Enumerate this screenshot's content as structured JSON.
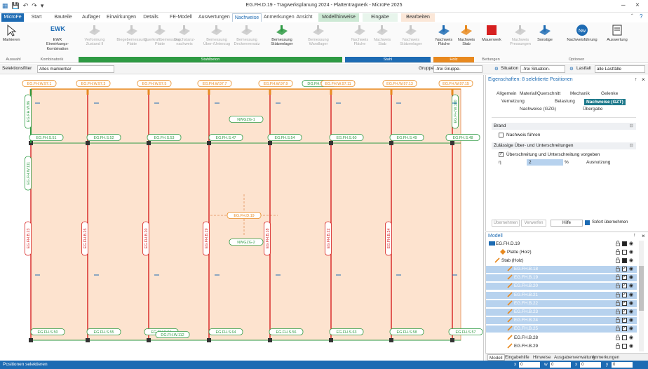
{
  "window": {
    "title": "EG.FH.D.19 - Tragwerksplanung 2024 - Plattentragwerk - MicroFe 2025"
  },
  "tabs": [
    {
      "label": "MicroFe",
      "kind": "file"
    },
    {
      "label": "Start",
      "kind": "plain"
    },
    {
      "label": "Bauteile",
      "kind": "plain"
    },
    {
      "label": "Auflager",
      "kind": "plain"
    },
    {
      "label": "Einwirkungen",
      "kind": "plain"
    },
    {
      "label": "Details",
      "kind": "plain"
    },
    {
      "label": "FE-Modell",
      "kind": "plain"
    },
    {
      "label": "Auswertungen",
      "kind": "plain"
    },
    {
      "label": "Nachweise",
      "kind": "active"
    },
    {
      "label": "Anmerkungen",
      "kind": "plain"
    },
    {
      "label": "Ansicht",
      "kind": "plain"
    },
    {
      "label": "Modellhinweise",
      "kind": "ctx"
    },
    {
      "label": "Eingabe",
      "kind": "ctx2"
    },
    {
      "label": "Bearbeiten",
      "kind": "ctx3"
    }
  ],
  "ribbon": {
    "buttons": [
      {
        "l1": "Markieren",
        "l2": "",
        "dis": false
      },
      {
        "l1": "EWK",
        "l2": "Einwirkungs-Kombination",
        "dis": false
      },
      {
        "l1": "Verformung",
        "l2": "Zustand II",
        "dis": true
      },
      {
        "l1": "Biegebemessung",
        "l2": "Platte",
        "dis": true
      },
      {
        "l1": "Querkraftbemessung",
        "l2": "Platte",
        "dis": true
      },
      {
        "l1": "Durchstanz-",
        "l2": "nachweis",
        "dis": true
      },
      {
        "l1": "Bemessung",
        "l2": "Über-/Unterzug",
        "dis": true
      },
      {
        "l1": "Bemessung",
        "l2": "Deckenversatz",
        "dis": true
      },
      {
        "l1": "Bemessung",
        "l2": "Stützenlager",
        "dis": false
      },
      {
        "l1": "Bemessung",
        "l2": "Wandlager",
        "dis": true
      },
      {
        "l1": "Nachweis",
        "l2": "Fläche",
        "dis": true
      },
      {
        "l1": "Nachweis",
        "l2": "Stab",
        "dis": true
      },
      {
        "l1": "Nachweis",
        "l2": "Stützenlager",
        "dis": true
      },
      {
        "l1": "Nachweis",
        "l2": "Fläche",
        "dis": false
      },
      {
        "l1": "Nachweis",
        "l2": "Stab",
        "dis": false
      },
      {
        "l1": "Mauerwerk",
        "l2": "",
        "dis": false
      },
      {
        "l1": "Nachweis",
        "l2": "Pressungen",
        "dis": true
      },
      {
        "l1": "Sonstige",
        "l2": "",
        "dis": false
      },
      {
        "l1": "Nachweisführung",
        "l2": "",
        "dis": false
      },
      {
        "l1": "Auswertung",
        "l2": "",
        "dis": false
      }
    ],
    "groups": [
      "Auswahl",
      "Kombinatorik",
      "Stahlbeton",
      "Stahl",
      "Holz",
      "Bettungen",
      "Optionen"
    ]
  },
  "filter": {
    "sel_label": "Selektionsfilter",
    "sel_value": "Alles markierbar",
    "gruppe_label": "Gruppe",
    "gruppe_value": "-frei Gruppe-",
    "situation_label": "Situation",
    "situation_value": "-frei Situation-",
    "lastfall_label": "Lastfall",
    "lastfall_value": "alle Lastfälle"
  },
  "drawing": {
    "top_labels": [
      "EG.FH.W.97.1",
      "EG.FH.W.97.3",
      "EG.FH.W.97.5",
      "EG.FH.W.97.7",
      "EG.FH.W.97.9",
      "DG.FH.W.115",
      "EG.FH.W.97.11",
      "EG.FH.W.97.13",
      "EG.FH.W.97.15"
    ],
    "mid_labels": [
      "EG.FH.S.51",
      "EG.FH.S.52",
      "EG.FH.S.53",
      "EG.FH.S.47",
      "EG.FH.S.54",
      "EG.FH.S.60",
      "EG.FH.S.49",
      "EG.FH.S.48"
    ],
    "bot_labels": [
      "EG.FH.S.50",
      "EG.FH.S.55",
      "EG.FH.S.61",
      "DG.FH.W.112",
      "EG.FH.S.64",
      "EG.FH.S.56",
      "EG.FH.S.63",
      "EG.FH.S.58",
      "EG.FH.S.57"
    ],
    "stab_labels": [
      "EG.FH.B.23",
      "EG.FH.B.25",
      "EG.FH.B.20",
      "EG.FH.B.19",
      "EG.FH.B.18",
      "EG.FH.B.22",
      "EG.FH.B.24"
    ],
    "side_labels": [
      "EG.FH.W.86",
      "EG.FH.W.111",
      "EG.FH.W.100"
    ],
    "nwgzg": [
      "NWGZG-1",
      "NWGZG-2"
    ],
    "center_label": "EG.FH.D.19"
  },
  "props": {
    "header": "Eigenschaften: 8 selektierte Positionen",
    "tabs_row1": [
      "Allgemein",
      "Material/Querschnitt",
      "Mechanik",
      "Gelenke"
    ],
    "tabs_row2": [
      "Vernetzung",
      "Belastung",
      "Nachweise (GZT)"
    ],
    "tabs_row3": [
      "Nachweise (GZG)",
      "Übergabe"
    ],
    "brand": "Brand",
    "nachweis": "Nachweis führen",
    "zul": "Zulässige Über- und Unterschreitungen",
    "ueber": "Überschreitung und Unterschreitung vorgeben",
    "eta": "η",
    "eta_val": "2",
    "pct": "%",
    "ausnutzung": "Ausnutzung",
    "btn_uebernehmen": "Übernehmen",
    "btn_verwerfen": "Verwerfen",
    "btn_hilfe": "Hilfe",
    "sofort": "Sofort übernehmen"
  },
  "model": {
    "header": "Modell",
    "root": "EG.FH.D.19",
    "platte": "Platte (Holz)",
    "stab": "Stab (Holz)",
    "items": [
      "EG.FH.B.18",
      "EG.FH.B.19",
      "EG.FH.B.20",
      "EG.FH.B.21",
      "EG.FH.B.22",
      "EG.FH.B.23",
      "EG.FH.B.24",
      "EG.FH.B.25",
      "EG.FH.B.28",
      "EG.FH.B.29"
    ],
    "selected_count": 8
  },
  "bottom_tabs": [
    "Modell",
    "Eingabehilfe",
    "Hinweise",
    "Ausgabenverwaltung",
    "Anmerkungen"
  ],
  "status": {
    "text": "Positionen selektieren",
    "x": "x",
    "w": "w",
    "xf": "x",
    "y": "y",
    "x_val": "0",
    "w_val": "0",
    "xf_val": "0",
    "y_val": "0"
  },
  "colors": {
    "accent": "#1d6bb3",
    "slab": "#fde3cf",
    "beam": "#d62020",
    "wall": "#e8891f",
    "green": "#2e9a43"
  }
}
